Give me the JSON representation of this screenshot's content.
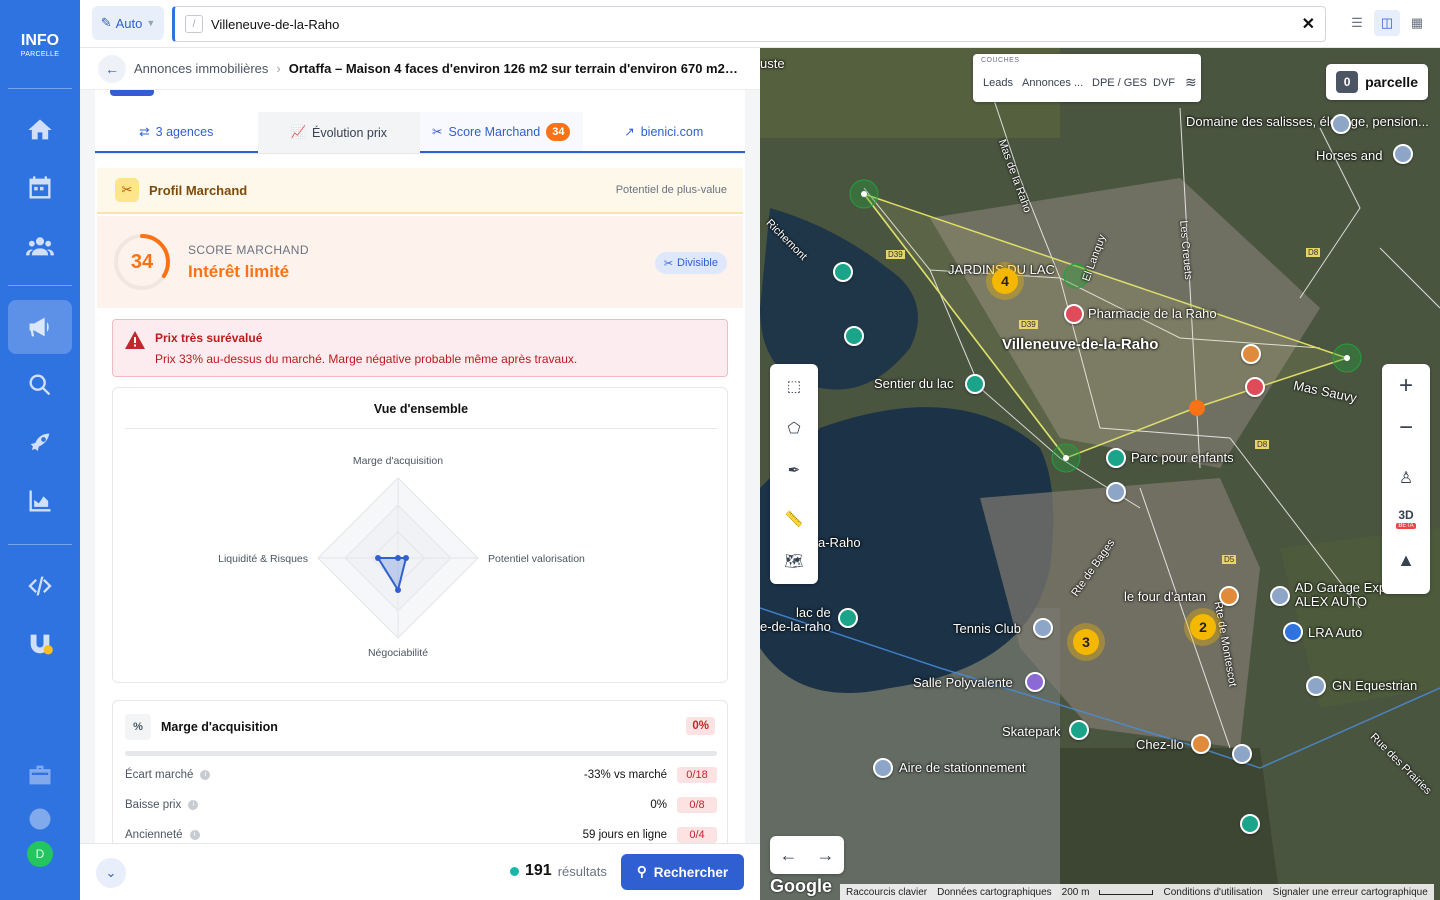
{
  "app": {
    "logo_main": "INFO",
    "logo_sub": "PARCELLE",
    "avatar_letter": "D"
  },
  "topbar": {
    "auto_label": "Auto",
    "search_value": "Villeneuve-de-la-Raho",
    "slash_hint": "/"
  },
  "breadcrumb": {
    "parent": "Annonces immobilières",
    "current": "Ortaffa – Maison 4 faces d'environ 126 m2 sur terrain d'environ 670 m2 avec..."
  },
  "tabs": [
    {
      "label": "3 agences",
      "icon": "arrows-icon"
    },
    {
      "label": "Évolution prix",
      "icon": "chart-line-icon"
    },
    {
      "label": "Score Marchand",
      "icon": "tools-icon",
      "badge": "34"
    },
    {
      "label": "bienici.com",
      "icon": "external-link-icon"
    }
  ],
  "profil": {
    "title": "Profil Marchand",
    "right": "Potentiel de plus-value"
  },
  "score": {
    "value": "34",
    "label": "SCORE MARCHAND",
    "verdict": "Intérêt limité",
    "tag": "Divisible",
    "fraction": 0.34
  },
  "alert": {
    "title": "Prix très surévalué",
    "desc": "Prix 33% au-dessus du marché. Marge négative probable même après travaux."
  },
  "overview": {
    "title": "Vue d'ensemble",
    "axes": [
      "Marge d'acquisition",
      "Potentiel valorisation",
      "Négociabilité",
      "Liquidité & Risques"
    ],
    "values": [
      0,
      0.1,
      0.4,
      0.25
    ]
  },
  "marge": {
    "title": "Marge d'acquisition",
    "pct": "0%",
    "rows": [
      {
        "label": "Écart marché",
        "value": "-33% vs marché",
        "score": "0/18"
      },
      {
        "label": "Baisse prix",
        "value": "0%",
        "score": "0/8"
      },
      {
        "label": "Ancienneté",
        "value": "59 jours en ligne",
        "score": "0/4"
      }
    ]
  },
  "bottom": {
    "results_count": "191",
    "results_label": "résultats",
    "search_button": "Rechercher"
  },
  "map": {
    "layers_title": "COUCHES",
    "layers": [
      "Leads",
      "Annonces ...",
      "DPE / GES",
      "DVF"
    ],
    "parcel_count": "0",
    "parcel_label": "parcelle",
    "zoom_in": "+",
    "zoom_out": "−",
    "btn_3d": "3D",
    "beta": "BETA",
    "labels": {
      "town": "Villeneuve-de-la-Raho",
      "jardin": "JARDINS DU LAC",
      "pharmacie": "Pharmacie de la Raho",
      "sentier": "Sentier du lac",
      "parc": "Parc pour enfants",
      "tennis": "Tennis Club",
      "salle": "Salle Polyvalente",
      "skatepark": "Skatepark",
      "chezllo": "Chez-llo",
      "parking": "Aire de stationnement",
      "four": "le four d'antan",
      "garage": "AD Garage Expert ALEX AUTO",
      "lra": "LRA Auto",
      "gn": "GN Equestrian",
      "domaine": "Domaine des salisses, élevage, pension...",
      "horses": "Horses and",
      "mas_sauvy": "Mas Sauvy",
      "lac": "lac de",
      "lac2": "e-de-la-raho",
      "raho": "a-Raho",
      "usté": "uste",
      "rue_prairies": "Rue des Prairies",
      "rte_bages": "Rte de Bages",
      "d39": "D39",
      "d8": "D8",
      "d5": "D5",
      "mas_raho": "Mas de la Raho",
      "creuets": "Les Creuets",
      "richemont": "Richemont",
      "montescot": "Rte de Montescot",
      "elanguy": "El Lanquy"
    },
    "clusters": [
      "4",
      "3",
      "2"
    ],
    "google": "Google",
    "attribution": [
      "Raccourcis clavier",
      "Données cartographiques",
      "200 m",
      "Conditions d'utilisation",
      "Signaler une erreur cartographique"
    ]
  }
}
